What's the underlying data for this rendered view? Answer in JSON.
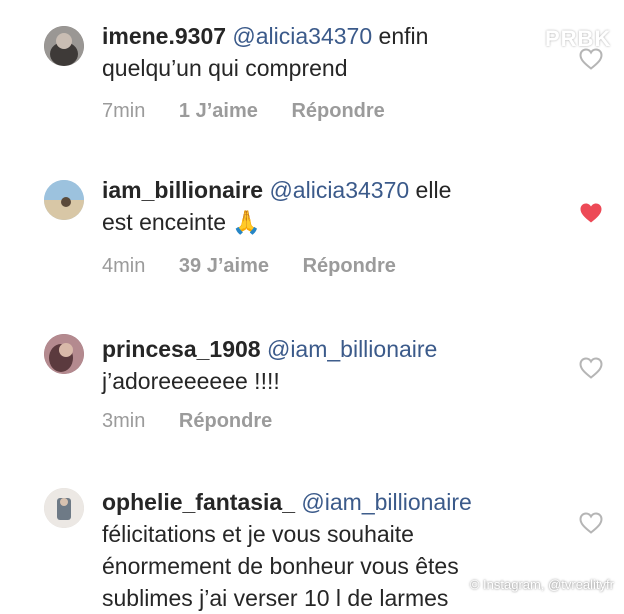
{
  "watermark": "PRBK",
  "credit": "© Instagram, @tvrealityfr",
  "comments": [
    {
      "username": "imene.9307",
      "mention": "@alicia34370",
      "text_line1": " enfin",
      "text_line2": "quelqu’un qui comprend",
      "time": "7min",
      "likes": "1 J’aime",
      "reply": "Répondre",
      "liked": false,
      "avatar_color": "#6d6a67"
    },
    {
      "username": "iam_billionaire",
      "mention": "@alicia34370",
      "text_line1": " elle",
      "text_line2": "est enceinte 🙏",
      "time": "4min",
      "likes": "39 J’aime",
      "reply": "Répondre",
      "liked": true,
      "avatar_color": "#8fb3cf"
    },
    {
      "username": "princesa_1908",
      "mention": "@iam_billionaire",
      "text_line1": "",
      "text_line2": "j’adoreeeeeee !!!!",
      "time": "3min",
      "likes": "",
      "reply": "Répondre",
      "liked": false,
      "avatar_color": "#8a5a66"
    },
    {
      "username": "ophelie_fantasia_",
      "mention": "@iam_billionaire",
      "text_line1": "",
      "text_line2": "félicitations et je vous souhaite",
      "text_line3": "énormement de bonheur vous êtes",
      "text_line4": "sublimes j’ai verser 10 l de larmes",
      "liked": false,
      "avatar_color": "#d9d4cf"
    }
  ],
  "colors": {
    "text": "#262626",
    "mention": "#3b5a8a",
    "meta": "#9b9b9b",
    "heart_liked": "#ed4956",
    "heart_outline": "#b5b5b5"
  },
  "icons": {
    "heart_outline": "heart-outline-icon",
    "heart_filled": "heart-filled-icon"
  }
}
